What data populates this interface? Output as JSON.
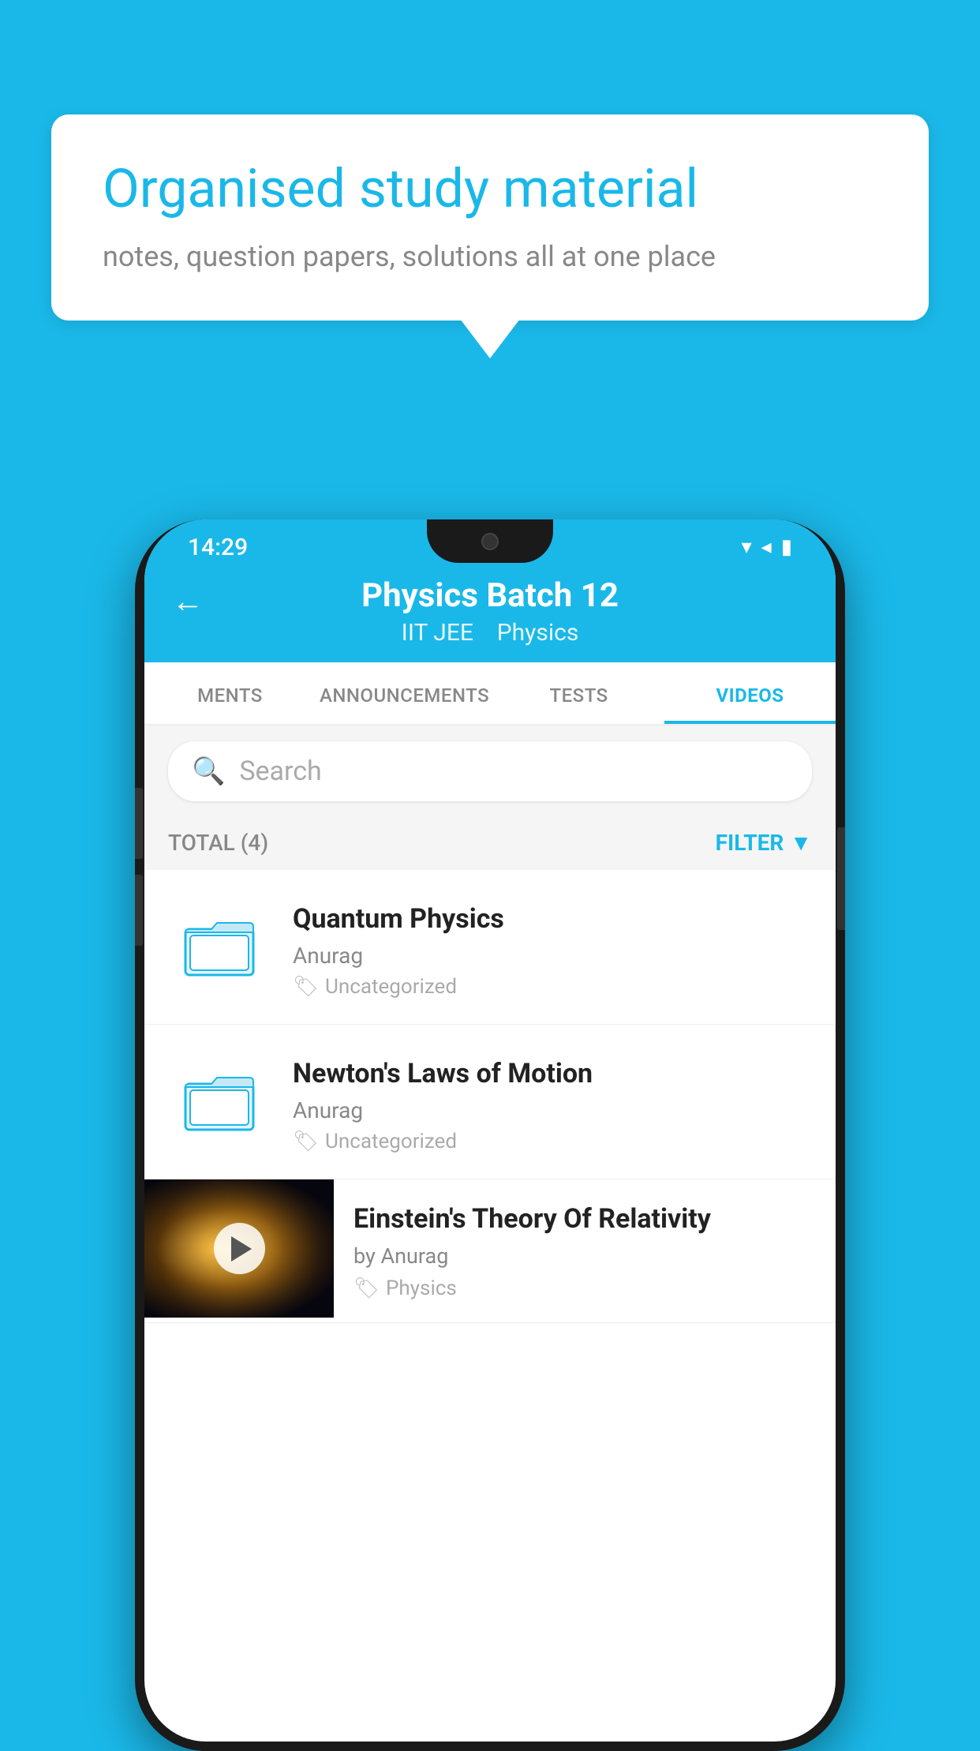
{
  "background": {
    "color": "#1ab8e8"
  },
  "speech_bubble": {
    "title": "Organised study material",
    "subtitle": "notes, question papers, solutions all at one place"
  },
  "phone": {
    "status_bar": {
      "time": "14:29",
      "icons": "▾◂▮"
    },
    "app_header": {
      "back_label": "←",
      "title": "Physics Batch 12",
      "subtitle_tag1": "IIT JEE",
      "subtitle_tag2": "Physics"
    },
    "tabs": [
      {
        "label": "MENTS",
        "active": false
      },
      {
        "label": "ANNOUNCEMENTS",
        "active": false
      },
      {
        "label": "TESTS",
        "active": false
      },
      {
        "label": "VIDEOS",
        "active": true
      }
    ],
    "search": {
      "placeholder": "Search"
    },
    "filter_row": {
      "total_label": "TOTAL (4)",
      "filter_label": "FILTER"
    },
    "videos": [
      {
        "title": "Quantum Physics",
        "author": "Anurag",
        "tag": "Uncategorized",
        "type": "folder"
      },
      {
        "title": "Newton's Laws of Motion",
        "author": "Anurag",
        "tag": "Uncategorized",
        "type": "folder"
      },
      {
        "title": "Einstein's Theory Of Relativity",
        "author": "by Anurag",
        "tag": "Physics",
        "type": "video"
      }
    ]
  }
}
